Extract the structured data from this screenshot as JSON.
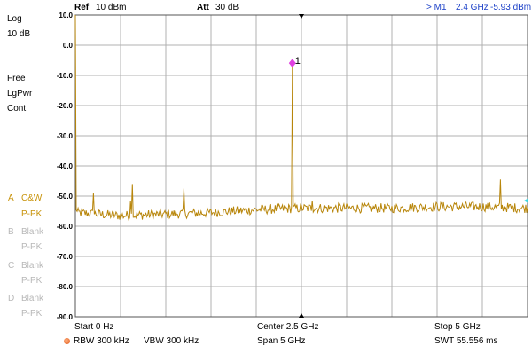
{
  "header": {
    "ref_label": "Ref",
    "ref_value": "10 dBm",
    "att_label": "Att",
    "att_value": "30 dB",
    "marker_readout": {
      "prefix": "> M1",
      "freq": "2.4 GHz",
      "level": "-5.93 dBm"
    }
  },
  "left_panel": {
    "scale_mode": "Log",
    "scale_div": "10 dB",
    "trigger": "Free",
    "detector_mode": "LgPwr",
    "sweep_mode": "Cont",
    "traces": [
      {
        "letter": "A",
        "mode": "C&W",
        "detector": "P-PK",
        "active": true
      },
      {
        "letter": "B",
        "mode": "Blank",
        "detector": "P-PK",
        "active": false
      },
      {
        "letter": "C",
        "mode": "Blank",
        "detector": "P-PK",
        "active": false
      },
      {
        "letter": "D",
        "mode": "Blank",
        "detector": "P-PK",
        "active": false
      }
    ]
  },
  "footer": {
    "start": "Start  0 Hz",
    "center": "Center  2.5 GHz",
    "stop": "Stop  5 GHz",
    "rbw": "RBW 300 kHz",
    "vbw": "VBW 300 kHz",
    "span": "Span   5 GHz",
    "swt": "SWT  55.556 ms"
  },
  "colors": {
    "trace": "#b8860b",
    "grid": "#b0b0b0",
    "marker": "#e040e0",
    "readout": "#1a3fc7"
  },
  "chart_data": {
    "type": "line",
    "title": "",
    "xlabel": "",
    "ylabel": "",
    "xlim": [
      0,
      5
    ],
    "x_unit": "GHz",
    "ylim": [
      -90,
      10
    ],
    "y_ticks": [
      10,
      0,
      -10,
      -20,
      -30,
      -40,
      -50,
      -60,
      -70,
      -80,
      -90
    ],
    "y_tick_labels": [
      "10.0",
      "0.0",
      "-10.0",
      "-20.0",
      "-30.0",
      "-40.0",
      "-50.0",
      "-60.0",
      "-70.0",
      "-80.0",
      "-90.0"
    ],
    "grid": true,
    "noise_floor_points": [
      {
        "x": 0.02,
        "y": -55.5
      },
      {
        "x": 0.5,
        "y": -56.5
      },
      {
        "x": 1.0,
        "y": -56.0
      },
      {
        "x": 1.5,
        "y": -55.5
      },
      {
        "x": 2.0,
        "y": -54.5
      },
      {
        "x": 2.5,
        "y": -54.0
      },
      {
        "x": 3.0,
        "y": -54.0
      },
      {
        "x": 3.5,
        "y": -54.0
      },
      {
        "x": 4.0,
        "y": -53.5
      },
      {
        "x": 4.5,
        "y": -53.5
      },
      {
        "x": 5.0,
        "y": -54.0
      }
    ],
    "spurs": [
      {
        "x": 0.0,
        "y": 10.0
      },
      {
        "x": 0.2,
        "y": -49.0
      },
      {
        "x": 0.61,
        "y": -51.5
      },
      {
        "x": 0.63,
        "y": -46.0
      },
      {
        "x": 1.2,
        "y": -47.5
      },
      {
        "x": 2.4,
        "y": -5.93
      },
      {
        "x": 2.4,
        "y": -30.0
      },
      {
        "x": 2.62,
        "y": -51.5
      },
      {
        "x": 4.7,
        "y": -44.5
      }
    ],
    "marker": {
      "label": "1",
      "x": 2.4,
      "y": -5.93
    }
  }
}
